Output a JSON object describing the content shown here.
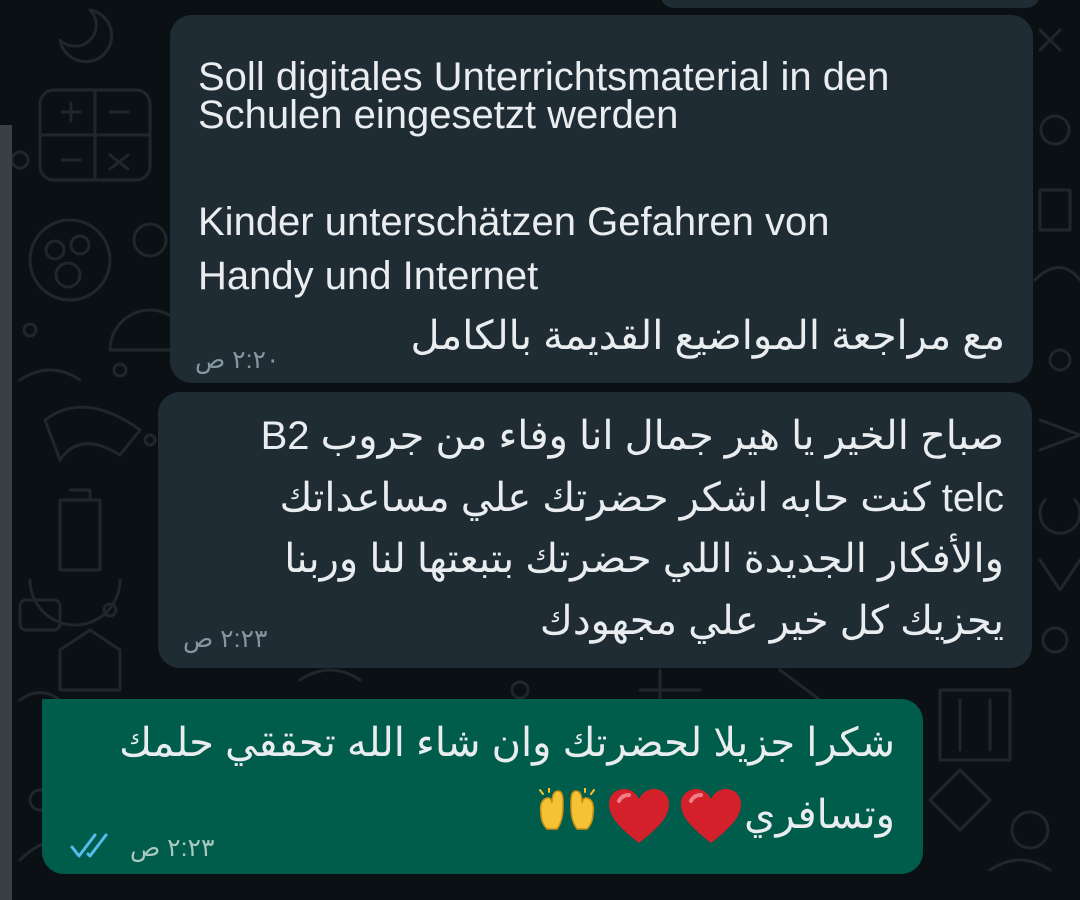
{
  "conversation": {
    "messages": [
      {
        "direction": "incoming",
        "lines": [
          "Soll digitales Unterrichtsmaterial in den",
          "Schulen eingesetzt werden",
          "Kinder unterschätzen Gefahren von",
          "Handy und Internet",
          "مع مراجعة المواضيع القديمة بالكامل"
        ],
        "time": "٢:٢٠ ص"
      },
      {
        "direction": "incoming",
        "lines": [
          "صباح الخير يا هير جمال انا وفاء من جروب B2",
          "telc كنت حابه اشكر حضرتك علي مساعداتك",
          "والأفكار الجديدة اللي حضرتك بتبعتها لنا وربنا",
          "يجزيك كل خير علي مجهودك"
        ],
        "time": "٢:٢٣ ص"
      },
      {
        "direction": "outgoing",
        "lines": [
          "شكرا جزيلا لحضرتك وان شاء الله تحققي حلمك",
          "وتسافري"
        ],
        "emojis": [
          "red-heart",
          "red-heart",
          "raised-hands"
        ],
        "time": "٢:٢٣ ص",
        "status": "read"
      }
    ]
  },
  "colors": {
    "background": "#0b1014",
    "incoming_bubble": "#202c33",
    "outgoing_bubble": "#005c4b",
    "text": "#e9edef",
    "timestamp": "#8696a0",
    "read_ticks": "#53bdeb"
  }
}
